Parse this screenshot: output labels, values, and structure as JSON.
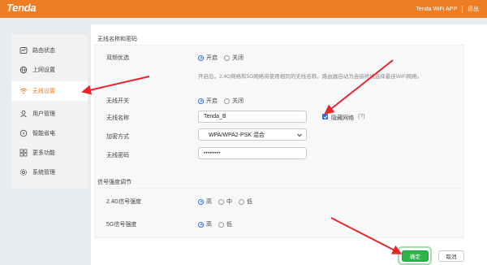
{
  "header": {
    "logo": "Tenda",
    "app_link": "Tenda WiFi APP",
    "logout": "退出"
  },
  "sidebar": {
    "items": [
      {
        "label": "路由状态",
        "icon": "router-status-icon"
      },
      {
        "label": "上网设置",
        "icon": "globe-icon"
      },
      {
        "label": "无线设置",
        "icon": "wifi-icon",
        "active": true
      },
      {
        "label": "用户管理",
        "icon": "user-icon"
      },
      {
        "label": "智能省电",
        "icon": "power-saving-icon"
      },
      {
        "label": "更多功能",
        "icon": "grid-icon"
      },
      {
        "label": "系统管理",
        "icon": "gear-icon"
      }
    ]
  },
  "wireless": {
    "section_title": "无线名称和密码",
    "dual_band_label": "双频优选",
    "on_label": "开启",
    "off_label": "关闭",
    "dual_band_hint": "开启后，2.4G网络和5G网络将使用相同的无线名称，路由器自动为连接终端选择最佳WiFi网络。",
    "wifi_switch_label": "无线开关",
    "ssid_label": "无线名称",
    "ssid_value": "Tenda_B",
    "hide_network_label": "隐藏网络",
    "hide_network_help": "(?)",
    "encryption_label": "加密方式",
    "encryption_value": "WPA/WPA2-PSK 混合",
    "password_label": "无线密码",
    "password_value": "••••••••"
  },
  "signal": {
    "section_title": "信号强度调节",
    "band24_label": "2.4G信号强度",
    "high": "高",
    "mid": "中",
    "low": "低",
    "band5_label": "5G信号强度"
  },
  "actions": {
    "ok": "确定",
    "cancel": "取消"
  },
  "colors": {
    "brand": "#ee7d23",
    "arrow": "#e8252a",
    "ok_button": "#2fb34a",
    "radio_accent": "#2b6de0"
  }
}
